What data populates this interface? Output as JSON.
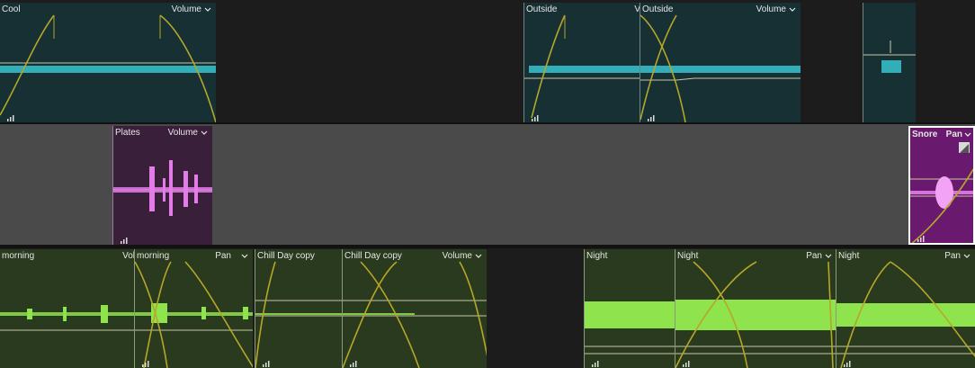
{
  "colors": {
    "track_bg_dark": "#1c1c1c",
    "track_bg_mid": "#4a4a4a",
    "teal_clip": "#173033",
    "teal_wave": "#36c4cf",
    "purple_clip": "#3a1f3a",
    "purple_selected": "#6a1a6e",
    "purple_wave": "#e37ce9",
    "green_clip": "#2a3a1e",
    "green_wave": "#8fe34d",
    "envelope_yellow": "#b6a729",
    "volume_line": "#c8c8a8"
  },
  "tracks": [
    {
      "name": "track-1",
      "clips": [
        {
          "name": "Cool",
          "param": "Volume"
        },
        {
          "name": "Outside",
          "param": "V"
        },
        {
          "name": "Outside",
          "param": "Volume"
        },
        {
          "name": "",
          "param": ""
        }
      ]
    },
    {
      "name": "track-2",
      "clips": [
        {
          "name": "Plates",
          "param": "Volume"
        },
        {
          "name": "Snore",
          "param": "Pan"
        }
      ]
    },
    {
      "name": "track-3",
      "clips": [
        {
          "name": "morning",
          "param": "Vol"
        },
        {
          "name": "morning",
          "param": "Pan"
        },
        {
          "name": "Chill Day copy",
          "param": ""
        },
        {
          "name": "Chill Day copy",
          "param": "Volume"
        },
        {
          "name": "Night",
          "param": ""
        },
        {
          "name": "Night",
          "param": "Pan"
        },
        {
          "name": "Night",
          "param": "Pan"
        }
      ]
    }
  ]
}
